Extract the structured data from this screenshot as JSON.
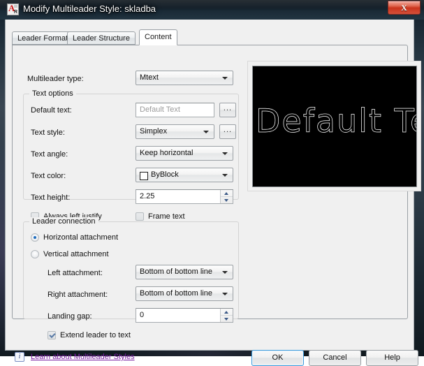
{
  "window": {
    "title": "Modify Multileader Style: skladba",
    "app_icon_name": "autocad-style-icon",
    "close_glyph": "X"
  },
  "tabs": [
    {
      "label": "Leader Format",
      "active": false
    },
    {
      "label": "Leader Structure",
      "active": false
    },
    {
      "label": "Content",
      "active": true
    }
  ],
  "content": {
    "multileader_type": {
      "label": "Multileader type:",
      "value": "Mtext"
    },
    "text_options": {
      "group_title": "Text options",
      "default_text": {
        "label": "Default text:",
        "value": "",
        "placeholder": "Default Text",
        "browse_label": "..."
      },
      "text_style": {
        "label": "Text style:",
        "value": "Simplex",
        "browse_label": "..."
      },
      "text_angle": {
        "label": "Text angle:",
        "value": "Keep horizontal"
      },
      "text_color": {
        "label": "Text color:",
        "value": "ByBlock",
        "swatch_color": "#ffffff"
      },
      "text_height": {
        "label": "Text height:",
        "value": "2.25"
      },
      "always_left_justify": {
        "label": "Always left justify",
        "checked": false
      },
      "frame_text": {
        "label": "Frame text",
        "checked": false
      }
    },
    "leader_connection": {
      "group_title": "Leader connection",
      "horizontal_attachment": {
        "label": "Horizontal attachment",
        "selected": true
      },
      "vertical_attachment": {
        "label": "Vertical attachment",
        "selected": false
      },
      "left_attachment": {
        "label": "Left attachment:",
        "value": "Bottom of bottom line"
      },
      "right_attachment": {
        "label": "Right attachment:",
        "value": "Bottom of bottom line"
      },
      "landing_gap": {
        "label": "Landing gap:",
        "value": "0"
      },
      "extend_leader_to_text": {
        "label": "Extend leader to text",
        "checked": true
      }
    }
  },
  "preview": {
    "text": "Default Text",
    "background_color": "#000000",
    "stroke_color": "#ffffff"
  },
  "footer": {
    "info_icon_glyph": "i",
    "help_link": "Learn about Multileader Styles",
    "ok_label": "OK",
    "cancel_label": "Cancel",
    "help_label": "Help"
  }
}
